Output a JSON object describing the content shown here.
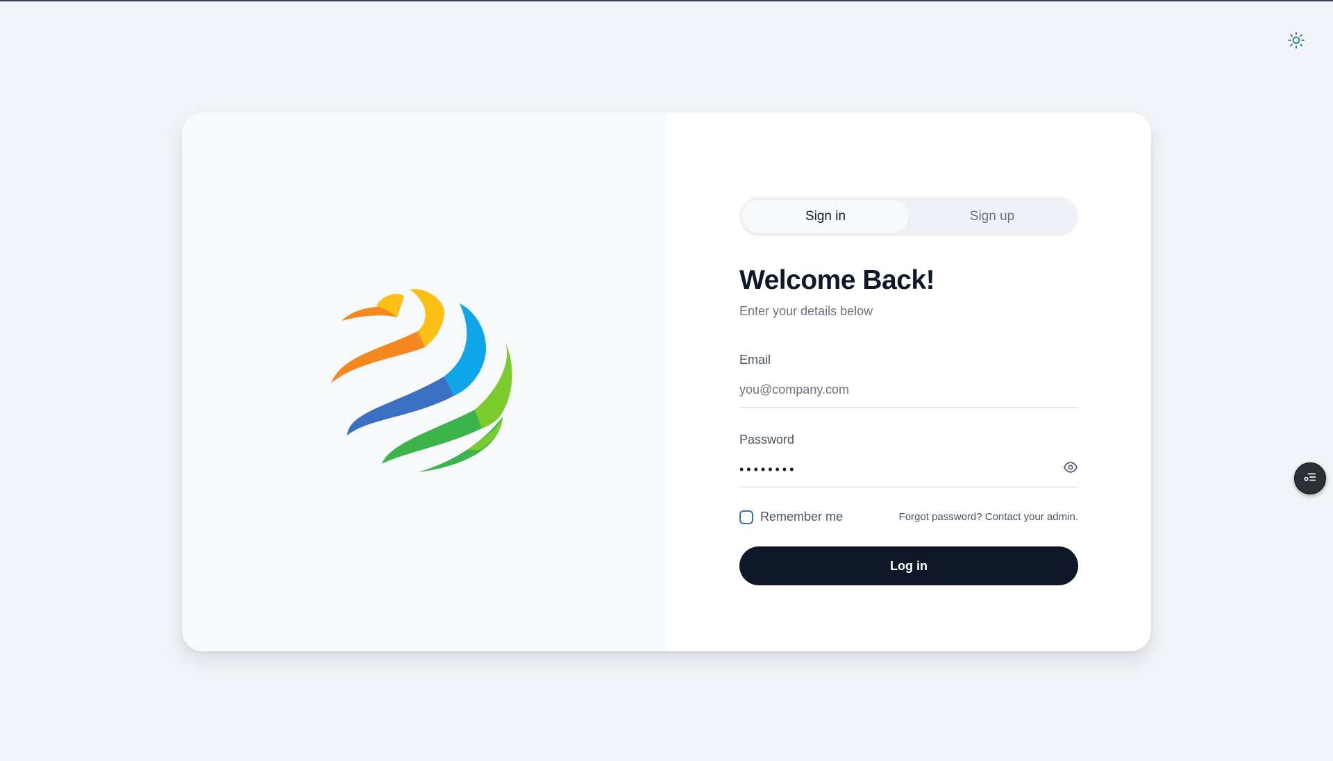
{
  "tabs": [
    {
      "label": "Sign in",
      "active": true
    },
    {
      "label": "Sign up",
      "active": false
    }
  ],
  "heading": "Welcome Back!",
  "subheading": "Enter your details below",
  "email": {
    "label": "Email",
    "placeholder": "you@company.com",
    "value": ""
  },
  "password": {
    "label": "Password",
    "value": "••••••••"
  },
  "remember_me": {
    "label": "Remember me",
    "checked": false
  },
  "forgot_link": "Forgot password? Contact your admin.",
  "login_button": "Log in",
  "icons": {
    "theme_toggle": "sun-icon",
    "password_toggle": "eye-icon",
    "floating_widget": "settings-list-icon",
    "brand_logo": "globe-swirl-logo"
  },
  "colors": {
    "page_bg": "#f1f4f8",
    "primary_button": "#0f1729",
    "accent_icon": "#2f7f8a",
    "checkbox_border": "#3b6fb6",
    "logo_orange": "#f5871f",
    "logo_yellow": "#fbbf15",
    "logo_blue": "#3a6fc1",
    "logo_cyan": "#0ea5e9",
    "logo_green": "#3cb44b",
    "logo_lime": "#7ccb2d"
  }
}
